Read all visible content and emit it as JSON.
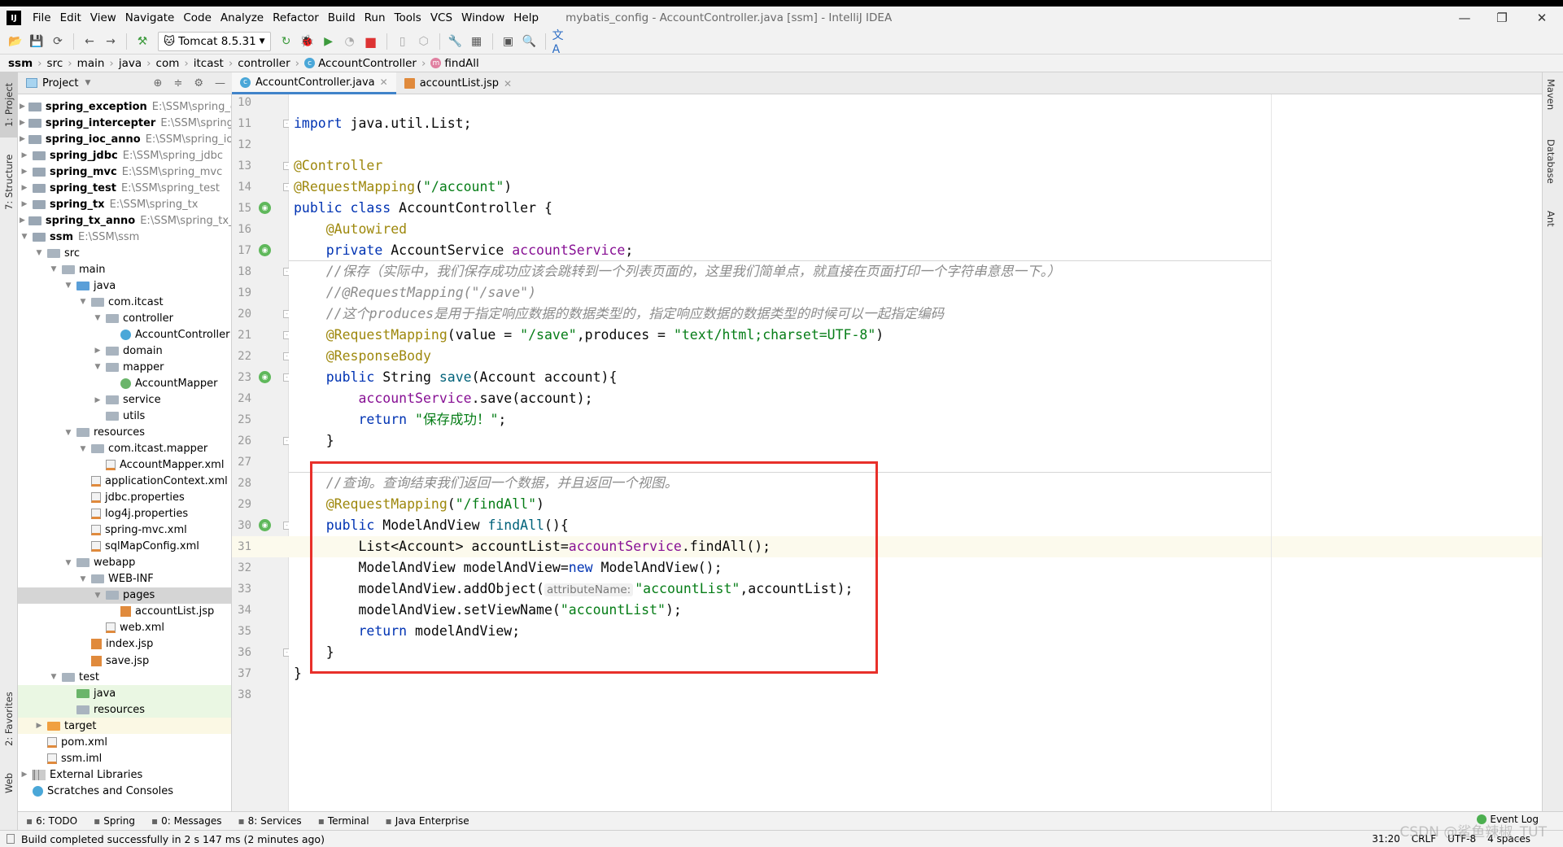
{
  "app": {
    "logo": "IJ",
    "title": "mybatis_config - AccountController.java [ssm] - IntelliJ IDEA"
  },
  "menu": [
    "File",
    "Edit",
    "View",
    "Navigate",
    "Code",
    "Analyze",
    "Refactor",
    "Build",
    "Run",
    "Tools",
    "VCS",
    "Window",
    "Help"
  ],
  "toolbar": {
    "run_config": "Tomcat 8.5.31"
  },
  "breadcrumbs": [
    "ssm",
    "src",
    "main",
    "java",
    "com",
    "itcast",
    "controller",
    "AccountController",
    "findAll"
  ],
  "left_stripe": {
    "project": "1: Project",
    "structure": "7: Structure",
    "favorites": "2: Favorites",
    "web": "Web"
  },
  "right_stripe": [
    "Maven",
    "Database",
    "Ant"
  ],
  "project_panel": {
    "title": "Project"
  },
  "tree": [
    {
      "label": "spring_exception",
      "path": "E:\\SSM\\spring_exce",
      "depth": 0,
      "arrow": "right",
      "icon": "module",
      "bold": true
    },
    {
      "label": "spring_intercepter",
      "path": "E:\\SSM\\spring_inte",
      "depth": 0,
      "arrow": "right",
      "icon": "module",
      "bold": true
    },
    {
      "label": "spring_ioc_anno",
      "path": "E:\\SSM\\spring_ioc_ar",
      "depth": 0,
      "arrow": "right",
      "icon": "module",
      "bold": true
    },
    {
      "label": "spring_jdbc",
      "path": "E:\\SSM\\spring_jdbc",
      "depth": 0,
      "arrow": "right",
      "icon": "module",
      "bold": true
    },
    {
      "label": "spring_mvc",
      "path": "E:\\SSM\\spring_mvc",
      "depth": 0,
      "arrow": "right",
      "icon": "module",
      "bold": true
    },
    {
      "label": "spring_test",
      "path": "E:\\SSM\\spring_test",
      "depth": 0,
      "arrow": "right",
      "icon": "module",
      "bold": true
    },
    {
      "label": "spring_tx",
      "path": "E:\\SSM\\spring_tx",
      "depth": 0,
      "arrow": "right",
      "icon": "module",
      "bold": true
    },
    {
      "label": "spring_tx_anno",
      "path": "E:\\SSM\\spring_tx_anno",
      "depth": 0,
      "arrow": "right",
      "icon": "module",
      "bold": true
    },
    {
      "label": "ssm",
      "path": "E:\\SSM\\ssm",
      "depth": 0,
      "arrow": "down",
      "icon": "module",
      "bold": true
    },
    {
      "label": "src",
      "depth": 1,
      "arrow": "down",
      "icon": "folder"
    },
    {
      "label": "main",
      "depth": 2,
      "arrow": "down",
      "icon": "folder"
    },
    {
      "label": "java",
      "depth": 3,
      "arrow": "down",
      "icon": "src-folder"
    },
    {
      "label": "com.itcast",
      "depth": 4,
      "arrow": "down",
      "icon": "package"
    },
    {
      "label": "controller",
      "depth": 5,
      "arrow": "down",
      "icon": "package"
    },
    {
      "label": "AccountController",
      "depth": 6,
      "arrow": "",
      "icon": "class"
    },
    {
      "label": "domain",
      "depth": 5,
      "arrow": "right",
      "icon": "package"
    },
    {
      "label": "mapper",
      "depth": 5,
      "arrow": "down",
      "icon": "package"
    },
    {
      "label": "AccountMapper",
      "depth": 6,
      "arrow": "",
      "icon": "interface"
    },
    {
      "label": "service",
      "depth": 5,
      "arrow": "right",
      "icon": "package"
    },
    {
      "label": "utils",
      "depth": 5,
      "arrow": "",
      "icon": "package"
    },
    {
      "label": "resources",
      "depth": 3,
      "arrow": "down",
      "icon": "res-folder"
    },
    {
      "label": "com.itcast.mapper",
      "depth": 4,
      "arrow": "down",
      "icon": "folder"
    },
    {
      "label": "AccountMapper.xml",
      "depth": 5,
      "arrow": "",
      "icon": "xml"
    },
    {
      "label": "applicationContext.xml",
      "depth": 4,
      "arrow": "",
      "icon": "xml"
    },
    {
      "label": "jdbc.properties",
      "depth": 4,
      "arrow": "",
      "icon": "props"
    },
    {
      "label": "log4j.properties",
      "depth": 4,
      "arrow": "",
      "icon": "props"
    },
    {
      "label": "spring-mvc.xml",
      "depth": 4,
      "arrow": "",
      "icon": "xml"
    },
    {
      "label": "sqlMapConfig.xml",
      "depth": 4,
      "arrow": "",
      "icon": "xml"
    },
    {
      "label": "webapp",
      "depth": 3,
      "arrow": "down",
      "icon": "web-folder"
    },
    {
      "label": "WEB-INF",
      "depth": 4,
      "arrow": "down",
      "icon": "folder"
    },
    {
      "label": "pages",
      "depth": 5,
      "arrow": "down",
      "icon": "folder",
      "selected": true
    },
    {
      "label": "accountList.jsp",
      "depth": 6,
      "arrow": "",
      "icon": "jsp"
    },
    {
      "label": "web.xml",
      "depth": 5,
      "arrow": "",
      "icon": "xml"
    },
    {
      "label": "index.jsp",
      "depth": 4,
      "arrow": "",
      "icon": "jsp"
    },
    {
      "label": "save.jsp",
      "depth": 4,
      "arrow": "",
      "icon": "jsp"
    },
    {
      "label": "test",
      "depth": 2,
      "arrow": "down",
      "icon": "folder"
    },
    {
      "label": "java",
      "depth": 3,
      "arrow": "",
      "icon": "test-folder",
      "test": true
    },
    {
      "label": "resources",
      "depth": 3,
      "arrow": "",
      "icon": "test-res-folder",
      "test": true
    },
    {
      "label": "target",
      "depth": 1,
      "arrow": "right",
      "icon": "excluded-folder",
      "excluded": true
    },
    {
      "label": "pom.xml",
      "depth": 1,
      "arrow": "",
      "icon": "maven"
    },
    {
      "label": "ssm.iml",
      "depth": 1,
      "arrow": "",
      "icon": "iml"
    },
    {
      "label": "External Libraries",
      "depth": 0,
      "arrow": "right",
      "icon": "library"
    },
    {
      "label": "Scratches and Consoles",
      "depth": 0,
      "arrow": "",
      "icon": "scratches"
    }
  ],
  "tabs": [
    {
      "label": "AccountController.java",
      "icon": "class",
      "active": true
    },
    {
      "label": "accountList.jsp",
      "icon": "jsp",
      "active": false
    }
  ],
  "editor": {
    "current_line": 31,
    "lines": [
      {
        "n": 10,
        "t": []
      },
      {
        "n": 11,
        "t": [
          [
            "kw",
            "import"
          ],
          [
            "pl",
            " java.util.List;"
          ]
        ],
        "fold": true
      },
      {
        "n": 12,
        "t": []
      },
      {
        "n": 13,
        "t": [
          [
            "an",
            "@Controller"
          ]
        ],
        "fold": true
      },
      {
        "n": 14,
        "t": [
          [
            "an",
            "@RequestMapping"
          ],
          [
            "pl",
            "("
          ],
          [
            "st",
            "\"/account\""
          ],
          [
            "pl",
            ")"
          ]
        ],
        "fold": true
      },
      {
        "n": 15,
        "t": [
          [
            "kw",
            "public class"
          ],
          [
            "pl",
            " AccountController {"
          ]
        ],
        "gicon": true
      },
      {
        "n": 16,
        "t": [
          [
            "pl",
            "    "
          ],
          [
            "an",
            "@Autowired"
          ]
        ]
      },
      {
        "n": 17,
        "t": [
          [
            "pl",
            "    "
          ],
          [
            "kw",
            "private"
          ],
          [
            "pl",
            " AccountService "
          ],
          [
            "fd",
            "accountService"
          ],
          [
            "pl",
            ";"
          ]
        ],
        "gicon": true
      },
      {
        "n": 18,
        "t": [
          [
            "pl",
            "    "
          ],
          [
            "cm",
            "//保存（实际中，我们保存成功应该会跳转到一个列表页面的，这里我们简单点，就直接在页面打印一个字符串意思一下。）"
          ]
        ],
        "fold": true
      },
      {
        "n": 19,
        "t": [
          [
            "pl",
            "    "
          ],
          [
            "cm",
            "//@RequestMapping(\"/save\")"
          ]
        ]
      },
      {
        "n": 20,
        "t": [
          [
            "pl",
            "    "
          ],
          [
            "cm",
            "//这个produces是用于指定响应数据的数据类型的，指定响应数据的数据类型的时候可以一起指定编码"
          ]
        ],
        "fold": true
      },
      {
        "n": 21,
        "t": [
          [
            "pl",
            "    "
          ],
          [
            "an",
            "@RequestMapping"
          ],
          [
            "pl",
            "(value = "
          ],
          [
            "st",
            "\"/save\""
          ],
          [
            "pl",
            ",produces = "
          ],
          [
            "st",
            "\"text/html;charset=UTF-8\""
          ],
          [
            "pl",
            ")"
          ]
        ],
        "fold": true
      },
      {
        "n": 22,
        "t": [
          [
            "pl",
            "    "
          ],
          [
            "an",
            "@ResponseBody"
          ]
        ],
        "fold": true
      },
      {
        "n": 23,
        "t": [
          [
            "pl",
            "    "
          ],
          [
            "kw",
            "public"
          ],
          [
            "pl",
            " String "
          ],
          [
            "mt",
            "save"
          ],
          [
            "pl",
            "(Account account){"
          ]
        ],
        "gicon": true,
        "fold": true
      },
      {
        "n": 24,
        "t": [
          [
            "pl",
            "        "
          ],
          [
            "fd",
            "accountService"
          ],
          [
            "pl",
            ".save(account);"
          ]
        ]
      },
      {
        "n": 25,
        "t": [
          [
            "pl",
            "        "
          ],
          [
            "kw",
            "return"
          ],
          [
            "pl",
            " "
          ],
          [
            "st",
            "\"保存成功！\""
          ],
          [
            "pl",
            ";"
          ]
        ]
      },
      {
        "n": 26,
        "t": [
          [
            "pl",
            "    }"
          ]
        ],
        "fold": true
      },
      {
        "n": 27,
        "t": []
      },
      {
        "n": 28,
        "t": [
          [
            "pl",
            "    "
          ],
          [
            "cm",
            "//查询。查询结束我们返回一个数据，并且返回一个视图。"
          ]
        ]
      },
      {
        "n": 29,
        "t": [
          [
            "pl",
            "    "
          ],
          [
            "an",
            "@RequestMapping"
          ],
          [
            "pl",
            "("
          ],
          [
            "st",
            "\"/findAll\""
          ],
          [
            "pl",
            ")"
          ]
        ]
      },
      {
        "n": 30,
        "t": [
          [
            "pl",
            "    "
          ],
          [
            "kw",
            "public"
          ],
          [
            "pl",
            " ModelAndView "
          ],
          [
            "mt",
            "findAll"
          ],
          [
            "pl",
            "(){"
          ]
        ],
        "gicon": true,
        "fold": true
      },
      {
        "n": 31,
        "t": [
          [
            "pl",
            "        List<Account> accountList="
          ],
          [
            "fd",
            "accountService"
          ],
          [
            "pl",
            ".findAll();"
          ]
        ],
        "bulb": true
      },
      {
        "n": 32,
        "t": [
          [
            "pl",
            "        ModelAndView modelAndView="
          ],
          [
            "kw",
            "new"
          ],
          [
            "pl",
            " ModelAndView();"
          ]
        ]
      },
      {
        "n": 33,
        "t": [
          [
            "pl",
            "        modelAndView.addObject("
          ],
          [
            "hint",
            "attributeName:"
          ],
          [
            "st",
            "\"accountList\""
          ],
          [
            "pl",
            ",accountList);"
          ]
        ]
      },
      {
        "n": 34,
        "t": [
          [
            "pl",
            "        modelAndView.setViewName("
          ],
          [
            "st",
            "\"accountList\""
          ],
          [
            "pl",
            ");"
          ]
        ]
      },
      {
        "n": 35,
        "t": [
          [
            "pl",
            "        "
          ],
          [
            "kw",
            "return"
          ],
          [
            "pl",
            " modelAndView;"
          ]
        ]
      },
      {
        "n": 36,
        "t": [
          [
            "pl",
            "    }"
          ]
        ],
        "fold": true
      },
      {
        "n": 37,
        "t": [
          [
            "pl",
            "}"
          ]
        ]
      },
      {
        "n": 38,
        "t": []
      }
    ]
  },
  "bottom_tools": [
    {
      "label": "6: TODO",
      "icon": "list-icon"
    },
    {
      "label": "Spring",
      "icon": "spring-icon"
    },
    {
      "label": "0: Messages",
      "icon": "messages-icon"
    },
    {
      "label": "8: Services",
      "icon": "services-icon"
    },
    {
      "label": "Terminal",
      "icon": "terminal-icon"
    },
    {
      "label": "Java Enterprise",
      "icon": "java-ee-icon"
    }
  ],
  "event_log": "Event Log",
  "status": {
    "message": "Build completed successfully in 2 s 147 ms (2 minutes ago)",
    "position": "31:20",
    "line_sep": "CRLF",
    "encoding": "UTF-8",
    "indent": "4 spaces"
  },
  "watermark": "CSDN @鲨鱼辣椒_TUT"
}
